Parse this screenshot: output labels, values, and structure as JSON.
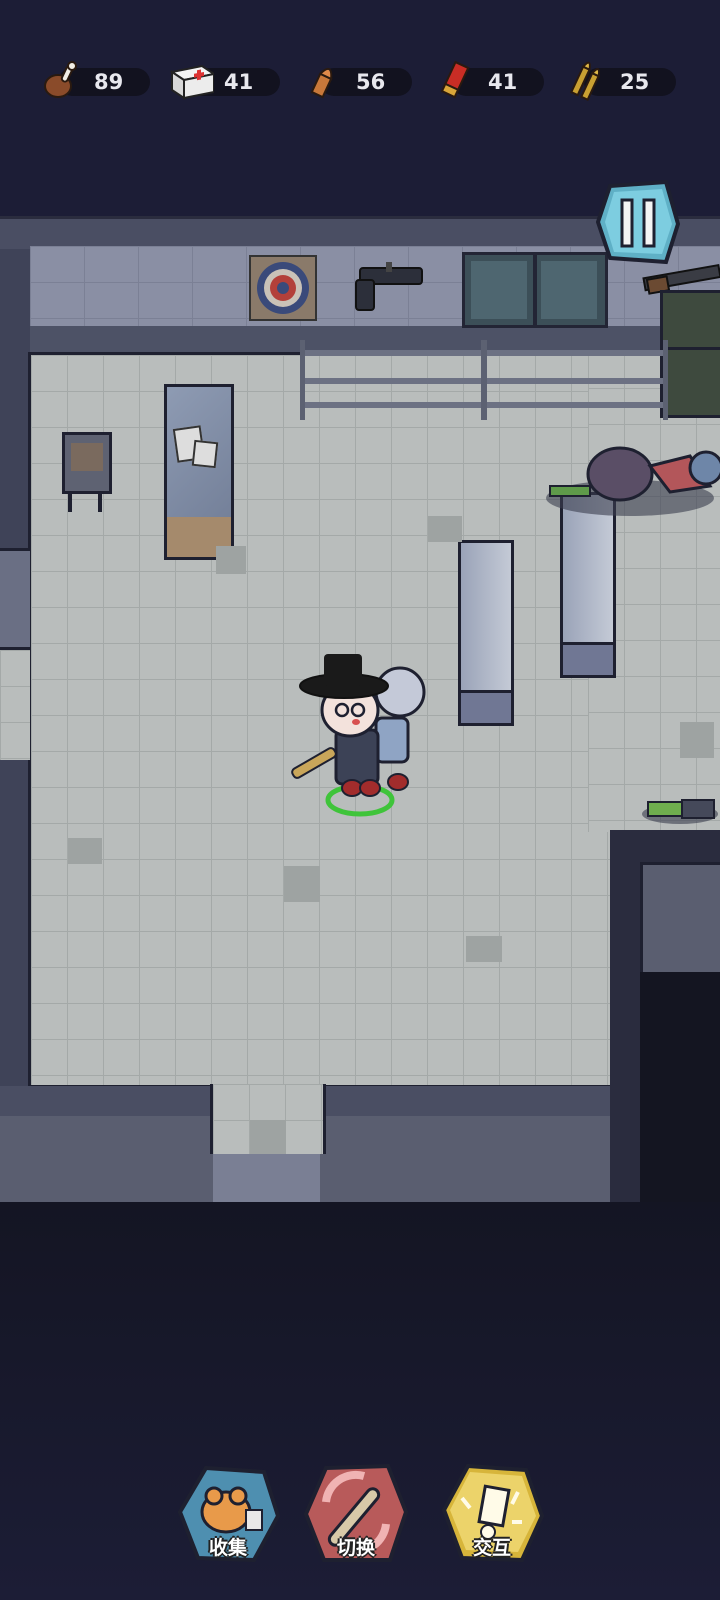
{
  "resources": [
    {
      "name": "meat-icon",
      "value": "89"
    },
    {
      "name": "medkit-icon",
      "value": "41"
    },
    {
      "name": "pistol-bullet-icon",
      "value": "56"
    },
    {
      "name": "shotgun-shell-icon",
      "value": "41"
    },
    {
      "name": "rifle-ammo-icon",
      "value": "25"
    }
  ],
  "actions": {
    "collect": "收集",
    "switch": "切换",
    "interact": "交互"
  },
  "colors": {
    "floor": "#b9bdbc",
    "wall": "#55596e",
    "selection_ring": "#3fc43a",
    "collect_badge": "#4e8fb0",
    "switch_badge": "#b85a5a",
    "interact_badge": "#d7b53a"
  }
}
